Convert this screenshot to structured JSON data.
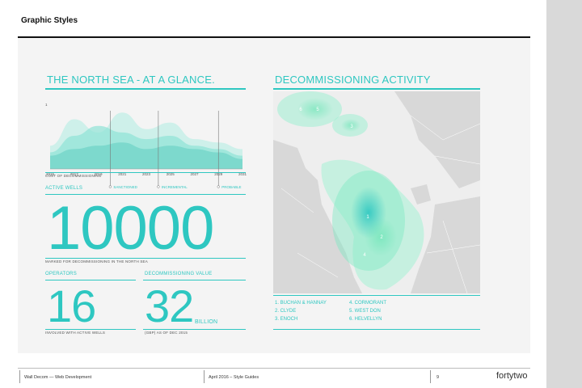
{
  "header": {
    "title": "Graphic Styles"
  },
  "left": {
    "title": "THE NORTH SEA - AT A GLANCE.",
    "chart_axis_value": "1",
    "chart_data": {
      "type": "area",
      "x": [
        "2015",
        "2017",
        "2019",
        "2021",
        "2023",
        "2025",
        "2027",
        "2029",
        "2031"
      ],
      "series": [
        {
          "values": [
            0.35,
            0.75,
            0.55,
            0.85,
            0.6,
            0.7,
            0.45,
            0.4,
            0.3
          ]
        },
        {
          "values": [
            0.25,
            0.5,
            0.65,
            0.55,
            0.45,
            0.5,
            0.35,
            0.3,
            0.2
          ]
        },
        {
          "values": [
            0.2,
            0.3,
            0.35,
            0.4,
            0.3,
            0.35,
            0.3,
            0.25,
            0.15
          ]
        }
      ],
      "markers": [
        {
          "label": "SANCTIONED",
          "x": "2020"
        },
        {
          "label": "INCREMENTAL",
          "x": "2024"
        },
        {
          "label": "PROBABLE",
          "x": "2029"
        }
      ],
      "ylabel": "1"
    },
    "chart_caption": "COST OF DECOMMISSIONING",
    "wells_label": "ACTIVE WELLS",
    "wells_value": "10000",
    "wells_caption": "MARKED FOR DECOMMISSIONING IN THE NORTH SEA",
    "operators_label": "OPERATORS",
    "operators_value": "16",
    "operators_caption": "INVOLVED WITH ACTIVE WELLS",
    "value_label": "DECOMMISSIONING VALUE",
    "value_value": "32",
    "value_unit": "BILLION",
    "value_caption": "(GBP) AS OF DEC 2015"
  },
  "right": {
    "title": "DECOMMISSIONING ACTIVITY",
    "hotspots": [
      {
        "label": "1",
        "intensity": 1.0
      },
      {
        "label": "2",
        "intensity": 0.8
      },
      {
        "label": "3",
        "intensity": 0.5
      },
      {
        "label": "4",
        "intensity": 0.4
      },
      {
        "label": "5",
        "intensity": 0.6
      },
      {
        "label": "6",
        "intensity": 0.5
      }
    ],
    "legend": [
      "1.   BUCHAN & HANNAY",
      "2.   CLYDE",
      "3.   ENOCH",
      "4.   CORMORANT",
      "5.   WEST DON",
      "6.   HELVELLYN"
    ]
  },
  "footer": {
    "left": "Wall Decom — Web Development",
    "middle": "April 2016  –  Style Guides",
    "page": "9",
    "brand": "fortytwo"
  },
  "colors": {
    "accent": "#2ec7c1",
    "panel": "#f4f4f4",
    "land": "#d8d8d8",
    "sea": "#eeeeee"
  }
}
